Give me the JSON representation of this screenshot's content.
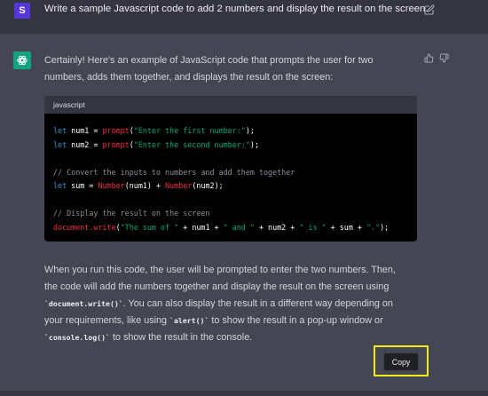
{
  "user_message": {
    "avatar_letter": "S",
    "text": "Write a sample Javascript code to add 2 numbers and display the result on the screen."
  },
  "assistant": {
    "intro": "Certainly! Here's an example of JavaScript code that prompts the user for two numbers, adds them together, and displays the result on the screen:",
    "code_block": {
      "language": "javascript",
      "lines": [
        "let num1 = prompt(\"Enter the first number:\");",
        "let num2 = prompt(\"Enter the second number:\");",
        "",
        "// Convert the inputs to numbers and add them together",
        "let sum = Number(num1) + Number(num2);",
        "",
        "// Display the result on the screen",
        "document.write(\"The sum of \" + num1 + \" and \" + num2 + \" is \" + sum + \".\");"
      ]
    },
    "outro": {
      "text_1": "When you run this code, the user will be prompted to enter the two numbers. Then, the code will add the numbers together and display the result on the screen using ",
      "code_1": "`document.write()`",
      "text_2": ". You can also display the result in a different way depending on your requirements, like using ",
      "code_2": "`alert()`",
      "text_3": " to show the result in a pop-up window or ",
      "code_3": "`console.log()`",
      "text_4": " to show the result in the console."
    },
    "copy_label": "Copy"
  },
  "icons": {
    "edit": "edit-icon",
    "thumbs_up": "thumbs-up-icon",
    "thumbs_down": "thumbs-down-icon",
    "assistant_logo": "openai-logo-icon"
  },
  "colors": {
    "assistant_avatar": "#10a37f",
    "user_avatar": "#5436da",
    "highlight": "#f2ea1b"
  }
}
